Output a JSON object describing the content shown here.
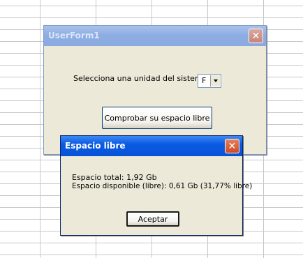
{
  "userform": {
    "title": "UserForm1",
    "close_glyph": "✕",
    "drive_label": "Selecciona una unidad del sistema:",
    "drive_value": "F",
    "check_button": "Comprobar su espacio libre"
  },
  "dialog": {
    "title": "Espacio libre",
    "close_glyph": "✕",
    "total_line": "Espacio total: 1,92 Gb",
    "free_line": "Espacio disponible (libre): 0,61 Gb (31,77% libre)",
    "ok_button": "Aceptar"
  }
}
